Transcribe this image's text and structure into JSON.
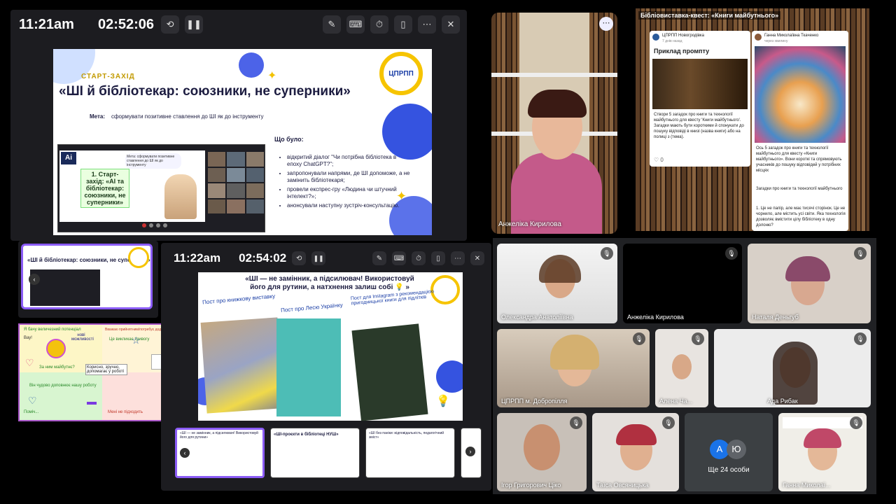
{
  "call1": {
    "clock": "11:21am",
    "timer": "02:52:06",
    "slide": {
      "kicker": "СТАРТ-ЗАХІД",
      "title": "«ШІ й бібліотекар: союзники, не суперники»",
      "meta_label": "Мета:",
      "meta_text": "сформувати позитивне ставлення до ШІ як до інструменту",
      "logo_text": "ЦПРПП",
      "inner_badge": "1. Старт-захід: «АІ та бібліотекар: союзники, не суперники»",
      "inner_bubble": "Мета: сформувати позитивне ставлення до ШІ як до інструменту",
      "what_title": "Що було:",
      "bullets": [
        "відкритий діалог \"Чи потрібна бібліотека в епоху ChatGPT?\";",
        "запропонували  напрями, де ШІ допоможе, а не замінить бібліотекаря;",
        "провели експрес-гру «Людина чи штучний інтелект?»;",
        "анонсували наступну зустріч-консультацію."
      ]
    }
  },
  "thumb_small": {
    "title": "«ШІ й бібліотекар: союзники, не суперники»"
  },
  "board": {
    "q1": "Я бачу величезний потенціал",
    "q1b": "нові можливості",
    "q2": "Вважаю прийнятним/потребує додаткових знань",
    "q3": "Це викликає тривогу",
    "q4": "За ним майбутнє?",
    "q5": "Він чудово доповнює нашу роботу",
    "q6": "Поміч...",
    "q7": "Мені не підходить",
    "note1": "Вау!",
    "note2": "Корисно, зручно, допомагає у роботі"
  },
  "call2": {
    "clock": "11:22am",
    "timer": "02:54:02",
    "slide": {
      "title": "«ШІ — не замінник, а підсилювач! Використовуй його для рутини, а натхнення залиш собі 💡 »",
      "cap1": "Пост про книжкову виставку",
      "cap2": "Пост про Лесю Українку",
      "cap3": "Пост для Instagram з рекомендацією пригодницької книги для підлітків"
    },
    "thumbs": [
      "«ШІ — не замінник, а підсилювач! Використовуй його для рутини»",
      "«ШІ-проєкти в бібліотеці НУШ»",
      "«ШІ без паніки: відповідальність, педагогічний зміст»",
      "..."
    ]
  },
  "speaker": {
    "name": "Анжеліка Кирилова"
  },
  "exhibition": {
    "title": "Бібліовиставка-квест: «Книги майбутнього»",
    "card1": {
      "author": "ЦПРПП Новогродівка",
      "time": "7 днів назад",
      "heading": "Приклад промпту",
      "text": "Створи 5 загадок про книги та технології майбутнього для квесту 'Книги майбутнього'. Загадки мають бути короткими й спонукати до пошуку відповіді в книзі (назва книги) або на полиці з (тема).",
      "likes": "0"
    },
    "card2": {
      "author": "Ганна Миколаївна Ткаченко",
      "time": "через хвилину",
      "text1": "Ось 5 загадок про книги та технології майбутнього для квесту «Книги майбутнього». Вони короткі та спрямовують учасників до пошуку відповідей у потрібних місцях",
      "text2": "Загадки про книги та технології майбутнього",
      "text3": "1. Це не папір, але має тисячі сторінок. Це не чорнило, але містить усі світи. Яка технологія дозволяє вмістити цілу бібліотеку в одну долоню?"
    }
  },
  "grid": {
    "tiles": [
      {
        "name": "Олександра Анатоліївна"
      },
      {
        "name": "Анжеліка Кирилова"
      },
      {
        "name": "Наталя Деньгуб"
      },
      {
        "name": "ЦПРПП м. Добропілля"
      },
      {
        "name": "Алена Ча..."
      },
      {
        "name": "Ада Рибак"
      },
      {
        "name": "Ігор Григорович Ціко"
      },
      {
        "name": "Таїса Овсяницька"
      },
      {
        "name": "Ще 24 особи"
      },
      {
        "name": "Ганна Миколаї..."
      }
    ],
    "avatars": [
      "А",
      "Ю"
    ]
  },
  "colors": {
    "accent": "#8b5cf6",
    "slide_blue": "#3b5bdb",
    "title_dark": "#1c1c40"
  }
}
